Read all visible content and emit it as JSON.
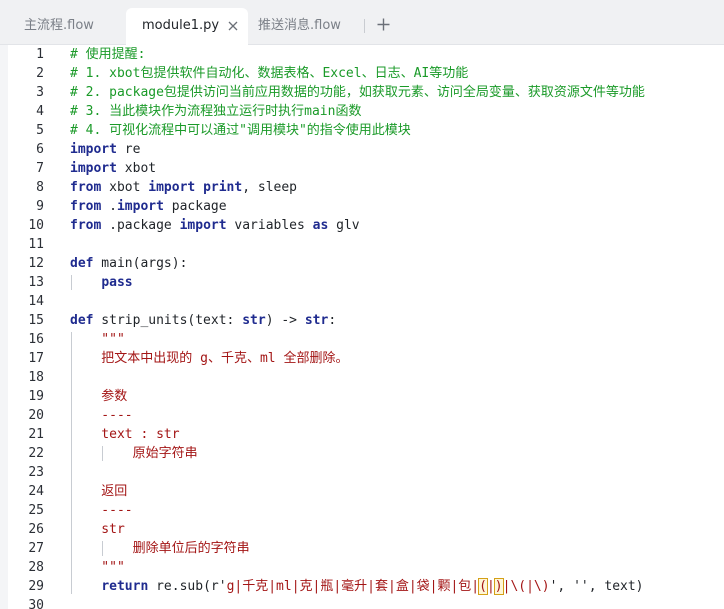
{
  "tabs": [
    {
      "label": "主流程.flow",
      "active": false
    },
    {
      "label": "module1.py",
      "active": true
    },
    {
      "label": "推送消息.flow",
      "active": false
    }
  ],
  "lines": [
    {
      "n": "1",
      "parts": [
        [
          "# 使用提醒:",
          "comment"
        ]
      ]
    },
    {
      "n": "2",
      "parts": [
        [
          "# 1. xbot包提供软件自动化、数据表格、Excel、日志、AI等功能",
          "comment"
        ]
      ]
    },
    {
      "n": "3",
      "parts": [
        [
          "# 2. package包提供访问当前应用数据的功能，如获取元素、访问全局变量、获取资源文件等功能",
          "comment"
        ]
      ]
    },
    {
      "n": "4",
      "parts": [
        [
          "# 3. 当此模块作为流程独立运行时执行main函数",
          "comment"
        ]
      ]
    },
    {
      "n": "5",
      "parts": [
        [
          "# 4. 可视化流程中可以通过\"调用模块\"的指令使用此模块",
          "comment"
        ]
      ]
    },
    {
      "n": "6",
      "parts": [
        [
          "import",
          "kw"
        ],
        [
          " re",
          "plain"
        ]
      ]
    },
    {
      "n": "7",
      "parts": [
        [
          "import",
          "kw"
        ],
        [
          " xbot",
          "plain"
        ]
      ]
    },
    {
      "n": "8",
      "parts": [
        [
          "from",
          "kw"
        ],
        [
          " xbot ",
          "plain"
        ],
        [
          "import",
          "kw"
        ],
        [
          " ",
          "plain"
        ],
        [
          "print",
          "kw"
        ],
        [
          ", sleep",
          "plain"
        ]
      ]
    },
    {
      "n": "9",
      "parts": [
        [
          "from",
          "kw"
        ],
        [
          " .",
          "plain"
        ],
        [
          "import",
          "kw"
        ],
        [
          " package",
          "plain"
        ]
      ]
    },
    {
      "n": "10",
      "parts": [
        [
          "from",
          "kw"
        ],
        [
          " .package ",
          "plain"
        ],
        [
          "import",
          "kw"
        ],
        [
          " variables ",
          "plain"
        ],
        [
          "as",
          "kw"
        ],
        [
          " glv",
          "plain"
        ]
      ]
    },
    {
      "n": "11",
      "parts": []
    },
    {
      "n": "12",
      "parts": [
        [
          "def",
          "kw"
        ],
        [
          " main(args):",
          "plain"
        ]
      ]
    },
    {
      "n": "13",
      "parts": [
        [
          "    ",
          "plain"
        ],
        [
          "pass",
          "kw"
        ]
      ]
    },
    {
      "n": "14",
      "parts": []
    },
    {
      "n": "15",
      "parts": [
        [
          "def",
          "kw"
        ],
        [
          " strip_units(text: ",
          "plain"
        ],
        [
          "str",
          "kw"
        ],
        [
          ") -> ",
          "plain"
        ],
        [
          "str",
          "kw"
        ],
        [
          ":",
          "plain"
        ]
      ]
    },
    {
      "n": "16",
      "parts": [
        [
          "    \"\"\"",
          "str"
        ]
      ]
    },
    {
      "n": "17",
      "parts": [
        [
          "    把文本中出现的 g、千克、ml 全部删除。",
          "str"
        ]
      ]
    },
    {
      "n": "18",
      "parts": []
    },
    {
      "n": "19",
      "parts": [
        [
          "    参数",
          "str"
        ]
      ]
    },
    {
      "n": "20",
      "parts": [
        [
          "    ----",
          "str"
        ]
      ]
    },
    {
      "n": "21",
      "parts": [
        [
          "    text : str",
          "str"
        ]
      ]
    },
    {
      "n": "22",
      "parts": [
        [
          "        原始字符串",
          "str"
        ]
      ]
    },
    {
      "n": "23",
      "parts": []
    },
    {
      "n": "24",
      "parts": [
        [
          "    返回",
          "str"
        ]
      ]
    },
    {
      "n": "25",
      "parts": [
        [
          "    ----",
          "str"
        ]
      ]
    },
    {
      "n": "26",
      "parts": [
        [
          "    str",
          "str"
        ]
      ]
    },
    {
      "n": "27",
      "parts": [
        [
          "        删除单位后的字符串",
          "str"
        ]
      ]
    },
    {
      "n": "28",
      "parts": [
        [
          "    \"\"\"",
          "str"
        ]
      ]
    },
    {
      "n": "29",
      "parts": [
        [
          "    ",
          "plain"
        ],
        [
          "return",
          "kw"
        ],
        [
          " re.sub(r'",
          "plain"
        ],
        [
          "g|千克|ml|克|瓶|毫升|套|盒|袋|颗|包|",
          "str"
        ],
        [
          "(",
          "strbox"
        ],
        [
          "|",
          "str"
        ],
        [
          ")",
          "strbox"
        ],
        [
          "|\\(|\\)",
          "str"
        ],
        [
          "', '', text)",
          "plain"
        ]
      ]
    },
    {
      "n": "30",
      "parts": []
    }
  ],
  "colors": {
    "comment": "#1a9a28",
    "keyword": "#1f2b8f",
    "string": "#a31515",
    "plain": "#1f2328",
    "bracket_highlight": "#d4a017"
  },
  "icons": {
    "close": "close-icon",
    "new_tab": "plus-icon"
  }
}
